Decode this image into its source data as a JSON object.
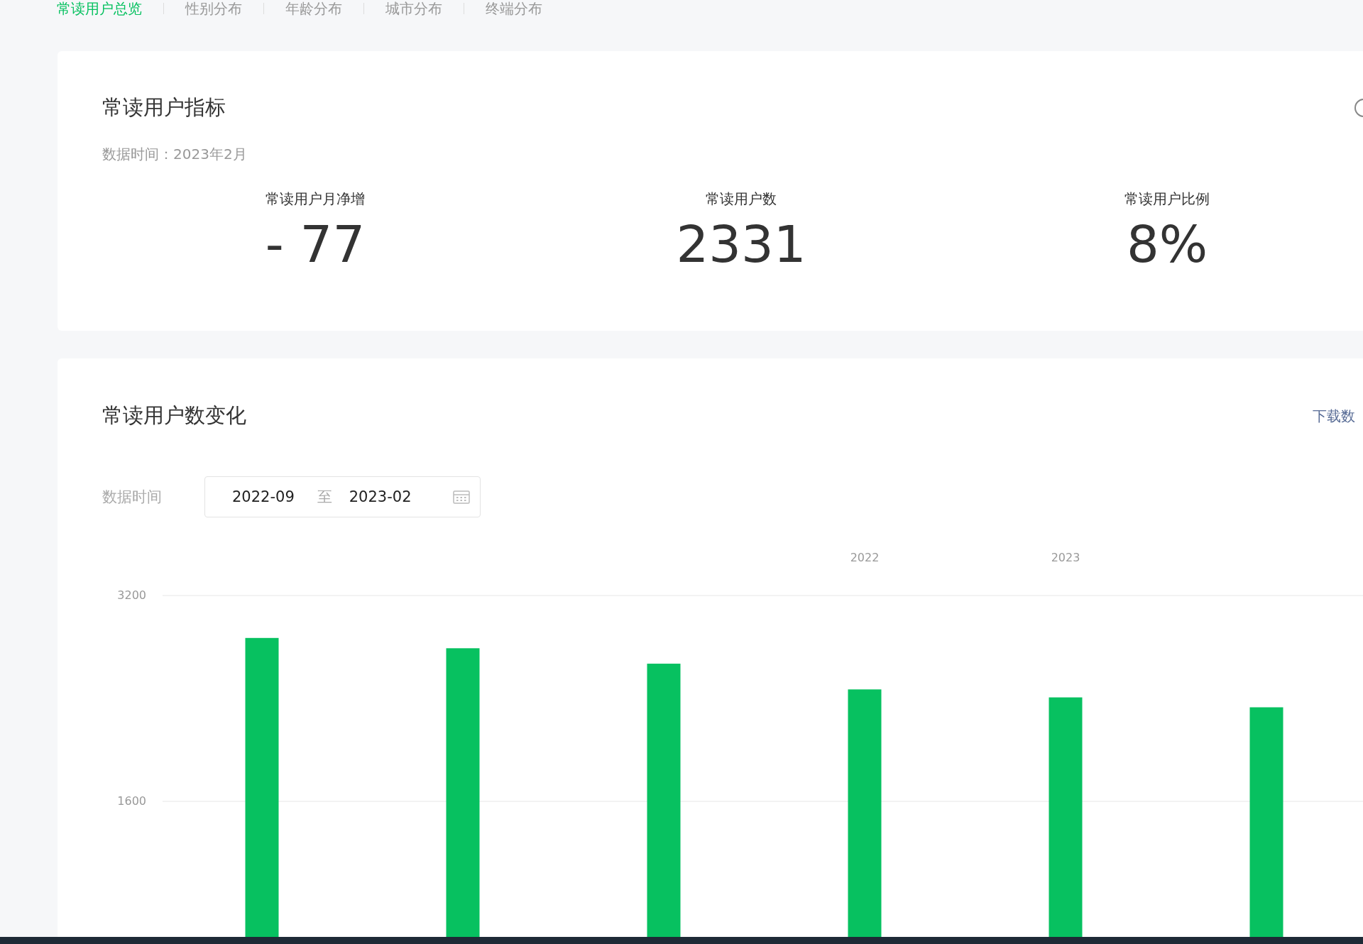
{
  "tabs": [
    {
      "label": "常读用户总览",
      "selected": true
    },
    {
      "label": "性别分布",
      "selected": false
    },
    {
      "label": "年龄分布",
      "selected": false
    },
    {
      "label": "城市分布",
      "selected": false
    },
    {
      "label": "终端分布",
      "selected": false
    }
  ],
  "indicator_card": {
    "title": "常读用户指标",
    "data_time": "数据时间：2023年2月",
    "metrics": [
      {
        "label": "常读用户月净增",
        "value": "- 77"
      },
      {
        "label": "常读用户数",
        "value": "2331"
      },
      {
        "label": "常读用户比例",
        "value": "8%"
      }
    ]
  },
  "trend_card": {
    "title": "常读用户数变化",
    "download_link": "下载数",
    "date_filter": {
      "label": "数据时间",
      "start": "2022-09",
      "separator": "至",
      "end": "2023-02"
    },
    "chart_data": {
      "type": "bar",
      "ylim": [
        541,
        3200
      ],
      "yticks": [
        1600,
        3200
      ],
      "series": [
        {
          "color": "#07c160",
          "values": [
            2870,
            2790,
            2670,
            2470,
            2408,
            2331
          ]
        }
      ]
    },
    "year_labels": [
      "2022",
      "2023"
    ]
  }
}
